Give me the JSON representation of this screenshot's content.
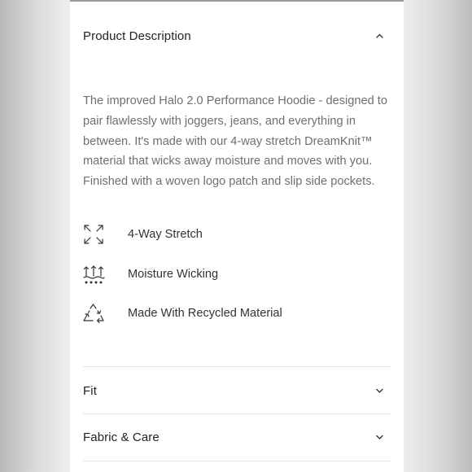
{
  "accordion": {
    "product_description": {
      "title": "Product Description",
      "state": "expanded",
      "body": "The improved Halo 2.0 Performance Hoodie - designed to pair flawlessly with joggers, jeans, and everything in between. It's made with our 4-way stretch DreamKnit™ material that wicks away moisture and moves with you. Finished with a woven logo patch and slip side pockets.",
      "features": [
        {
          "icon": "four-way-stretch-icon",
          "label": "4-Way Stretch"
        },
        {
          "icon": "moisture-wicking-icon",
          "label": "Moisture Wicking"
        },
        {
          "icon": "recycle-icon",
          "label": "Made With Recycled Material"
        }
      ]
    },
    "fit": {
      "title": "Fit",
      "state": "collapsed"
    },
    "fabric_care": {
      "title": "Fabric & Care",
      "state": "collapsed"
    }
  },
  "colors": {
    "card_background": "#ffffff",
    "page_background": "#eeeeee",
    "title_text": "#222222",
    "body_text": "#6f6f6f",
    "divider": "#e4e4e4"
  }
}
